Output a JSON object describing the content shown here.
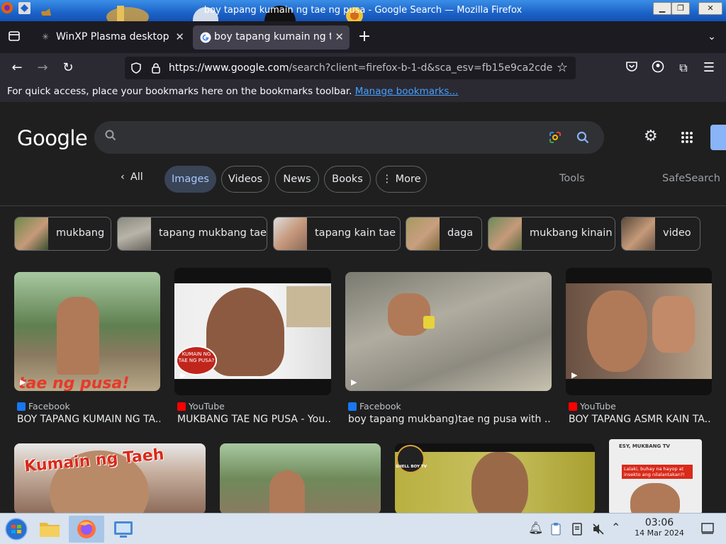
{
  "window": {
    "title": "boy tapang kumain ng tae ng pusa - Google Search — Mozilla Firefox",
    "controls": [
      "minimize",
      "maximize",
      "close"
    ]
  },
  "tabs": [
    {
      "title": "WinXP Plasma desktop th",
      "active": false
    },
    {
      "title": "boy tapang kumain ng ta",
      "active": true
    }
  ],
  "nav": {
    "url_domain": "https://www.google.com",
    "url_rest": "/search?client=firefox-b-1-d&sca_esv=fb15e9ca2cde"
  },
  "bookmarks": {
    "prompt": "For quick access, place your bookmarks here on the bookmarks toolbar.",
    "manage_link": "Manage bookmarks..."
  },
  "google": {
    "logo": "Google",
    "search_value": "",
    "filters": {
      "all": "All",
      "images": "Images",
      "videos": "Videos",
      "news": "News",
      "books": "Books",
      "more": "More",
      "tools": "Tools",
      "safesearch": "SafeSearch"
    },
    "chips": [
      {
        "label": "mukbang"
      },
      {
        "label": "tapang mukbang tae"
      },
      {
        "label": "tapang kain tae"
      },
      {
        "label": "daga"
      },
      {
        "label": "mukbang kinain"
      },
      {
        "label": "video"
      }
    ],
    "results": [
      {
        "source": "Facebook",
        "caption": "BOY TAPANG KUMAIN NG TA...",
        "overlay": "tae ng pusa!"
      },
      {
        "source": "YouTube",
        "caption": "MUKBANG TAE NG PUSA - You...",
        "overlay": "KUMAIN NG TAE NG PUSA?"
      },
      {
        "source": "Facebook",
        "caption": "boy tapang mukbang)tae ng pusa with ..."
      },
      {
        "source": "YouTube",
        "caption": "BOY TAPANG ASMR KAIN TA..."
      }
    ],
    "row2": [
      {
        "overlay": "Kumain ng Taeh"
      },
      {
        "overlay": ""
      },
      {
        "overlay": "SHELL BOY TV"
      },
      {
        "overlay": "ESY, MUKBANG TV",
        "sub": "Lalaki, buhay na hayop at insekto ang nilalantakan?!"
      }
    ]
  },
  "taskbar": {
    "time": "03:06",
    "date": "14 Mar 2024"
  },
  "colors": {
    "titlebar": "#1c63c9",
    "accent_link": "#45a1ff",
    "selected_filter": "#394457"
  }
}
